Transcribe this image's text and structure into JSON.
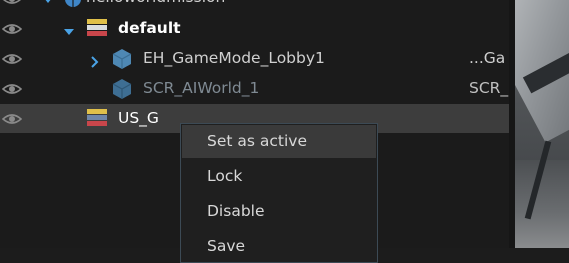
{
  "outliner": {
    "rows": [
      {
        "label": "helloworldmission"
      },
      {
        "label": "default"
      },
      {
        "label": "EH_GameMode_Lobby1",
        "type": "...Ga"
      },
      {
        "label": "SCR_AIWorld_1",
        "type": "SCR_"
      },
      {
        "label": "US_G"
      }
    ]
  },
  "context_menu": {
    "items": [
      {
        "label": "Set as active"
      },
      {
        "label": "Lock"
      },
      {
        "label": "Disable"
      },
      {
        "label": "Save"
      }
    ]
  },
  "colors": {
    "arrow_blue": "#4aa3e6",
    "entity_icon_blue": "#4e88b4",
    "menu_border": "#3c4a55",
    "selected_row": "#3d3d3d",
    "hover_item": "#3a3a3a"
  },
  "icons": {
    "visibility": "eye-icon",
    "world": "globe-icon",
    "layer": "layer-stack-icon",
    "entity": "cube-icon"
  }
}
